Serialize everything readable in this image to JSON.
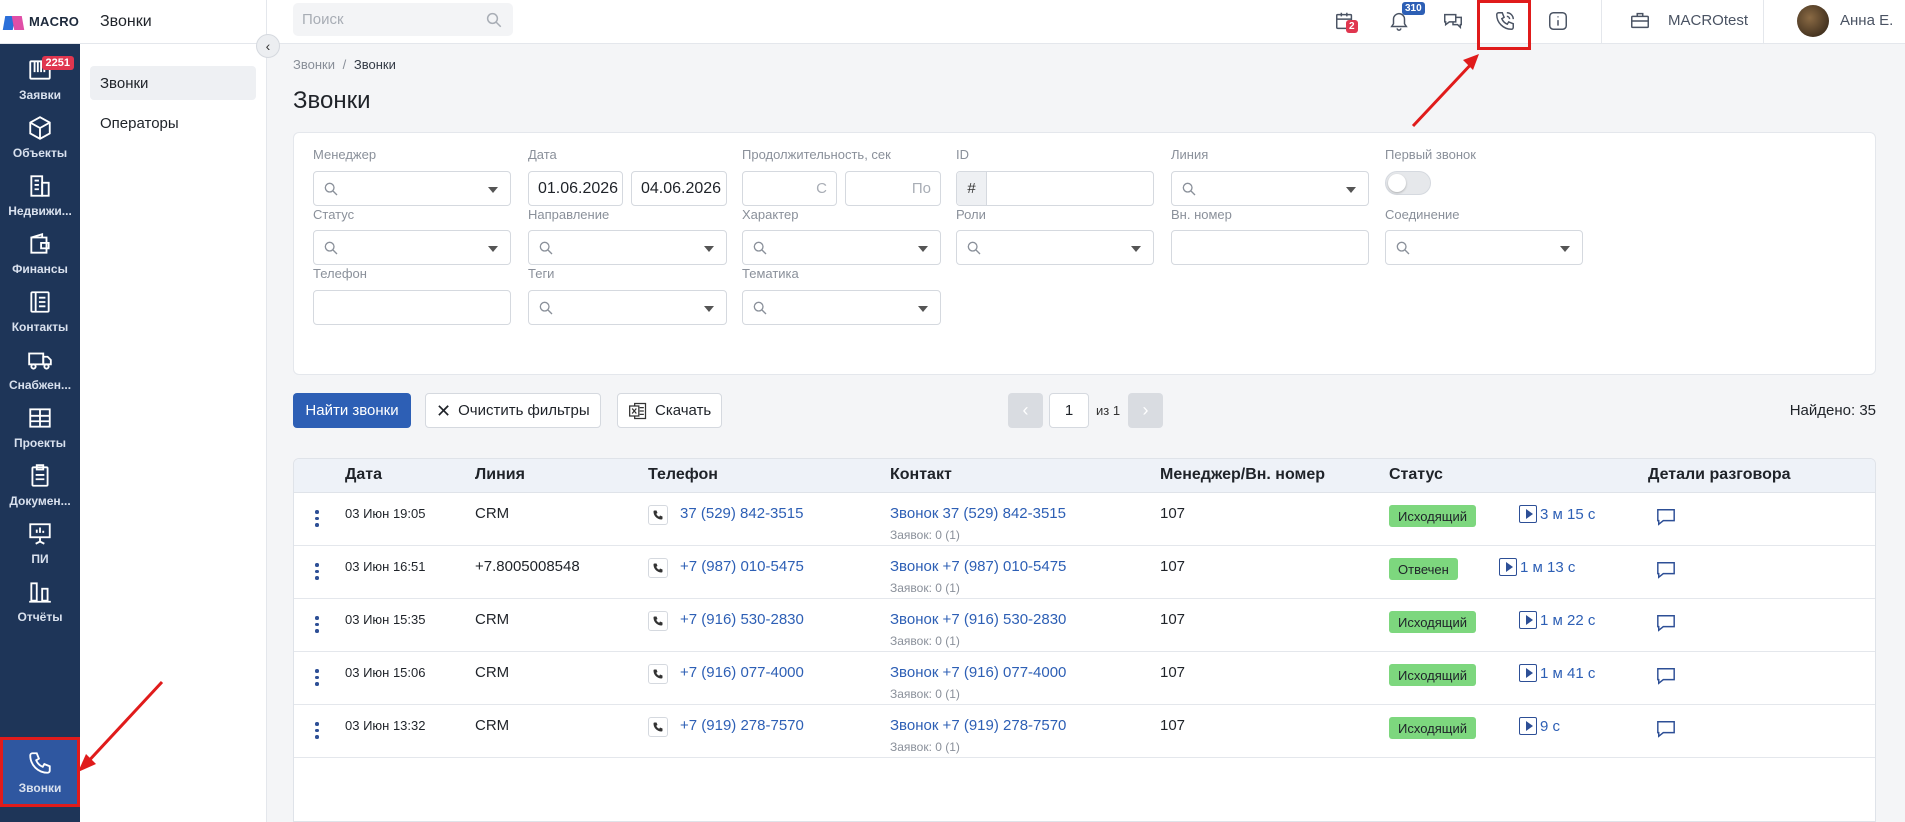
{
  "app": {
    "logo_text": "MACRO"
  },
  "rail": [
    {
      "label": "Заявки",
      "icon": "requests-icon",
      "badge": "2251"
    },
    {
      "label": "Объекты",
      "icon": "box-icon"
    },
    {
      "label": "Недвижи...",
      "icon": "building-icon"
    },
    {
      "label": "Финансы",
      "icon": "wallet-icon"
    },
    {
      "label": "Контакты",
      "icon": "contacts-icon"
    },
    {
      "label": "Снабжен...",
      "icon": "truck-icon"
    },
    {
      "label": "Проекты",
      "icon": "projects-icon"
    },
    {
      "label": "Докумен...",
      "icon": "clipboard-icon"
    },
    {
      "label": "ПИ",
      "icon": "presentation-icon"
    },
    {
      "label": "Отчёты",
      "icon": "reports-icon"
    },
    {
      "label": "Звонки",
      "icon": "phone-icon",
      "active": true
    }
  ],
  "subnav": {
    "title": "Звонки",
    "items": [
      {
        "label": "Звонки",
        "active": true
      },
      {
        "label": "Операторы"
      }
    ]
  },
  "topbar": {
    "search_placeholder": "Поиск",
    "calendar_badge": "2",
    "notifications_badge": "310",
    "company": "MACROtest",
    "user": "Анна Е."
  },
  "breadcrumb": {
    "root": "Звонки",
    "sep": "/",
    "current": "Звонки"
  },
  "page_title": "Звонки",
  "filters": {
    "manager": {
      "label": "Менеджер"
    },
    "date": {
      "label": "Дата",
      "from": "01.06.2026",
      "to": "04.06.2026"
    },
    "duration": {
      "label": "Продолжительность, сек",
      "from_placeholder": "С",
      "to_placeholder": "По"
    },
    "id": {
      "label": "ID",
      "prefix": "#"
    },
    "line": {
      "label": "Линия"
    },
    "first_call": {
      "label": "Первый звонок",
      "value": false
    },
    "status": {
      "label": "Статус"
    },
    "direction": {
      "label": "Направление"
    },
    "character": {
      "label": "Характер"
    },
    "roles": {
      "label": "Роли"
    },
    "ext_number": {
      "label": "Вн. номер"
    },
    "connection": {
      "label": "Соединение"
    },
    "phone": {
      "label": "Телефон"
    },
    "tags": {
      "label": "Теги"
    },
    "topic": {
      "label": "Тематика"
    }
  },
  "toolbar": {
    "find_label": "Найти звонки",
    "clear_label": "Очистить фильтры",
    "download_label": "Скачать",
    "page": "1",
    "of_label": "из 1",
    "found_label": "Найдено: 35"
  },
  "colors": {
    "accent": "#2d5fb5",
    "sidebar": "#1e3558",
    "status_green": "#7dd77e",
    "highlight_red": "#e01b1b"
  },
  "table": {
    "columns": [
      "Дата",
      "Линия",
      "Телефон",
      "Контакт",
      "Менеджер/Вн. номер",
      "Статус",
      "Детали разговора"
    ],
    "rows": [
      {
        "date": "03 Июн 19:05",
        "line": "CRM",
        "phone": "37 (529) 842-3515",
        "contact": "Звонок 37 (529) 842-3515",
        "requests": "Заявок: 0 (1)",
        "manager": "107",
        "status": "Исходящий",
        "duration": "3 м 15 с"
      },
      {
        "date": "03 Июн 16:51",
        "line": "+7.8005008548",
        "phone": "+7 (987) 010-5475",
        "contact": "Звонок +7 (987) 010-5475",
        "requests": "Заявок: 0 (1)",
        "manager": "107",
        "status": "Отвечен",
        "duration": "1 м 13 с"
      },
      {
        "date": "03 Июн 15:35",
        "line": "CRM",
        "phone": "+7 (916) 530-2830",
        "contact": "Звонок +7 (916) 530-2830",
        "requests": "Заявок: 0 (1)",
        "manager": "107",
        "status": "Исходящий",
        "duration": "1 м 22 с"
      },
      {
        "date": "03 Июн 15:06",
        "line": "CRM",
        "phone": "+7 (916) 077-4000",
        "contact": "Звонок +7 (916) 077-4000",
        "requests": "Заявок: 0 (1)",
        "manager": "107",
        "status": "Исходящий",
        "duration": "1 м 41 с"
      },
      {
        "date": "03 Июн 13:32",
        "line": "CRM",
        "phone": "+7 (919) 278-7570",
        "contact": "Звонок +7 (919) 278-7570",
        "requests": "Заявок: 0 (1)",
        "manager": "107",
        "status": "Исходящий",
        "duration": "9 с"
      }
    ]
  }
}
